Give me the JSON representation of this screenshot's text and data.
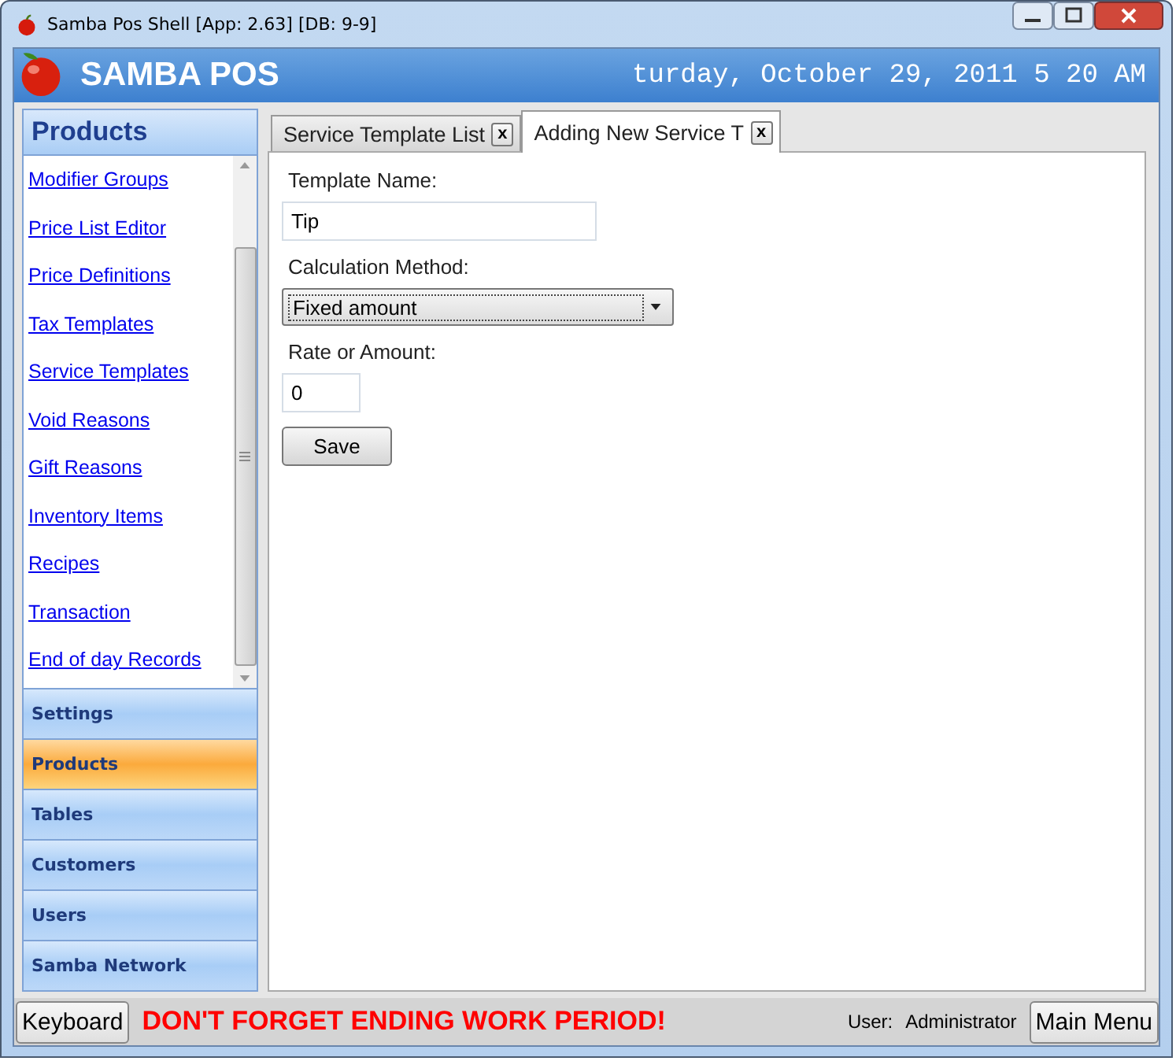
{
  "window": {
    "title": "Samba Pos Shell [App: 2.63] [DB: 9-9]"
  },
  "header": {
    "app_name": "SAMBA POS",
    "date": "turday, October 29, 2011 5 20 AM"
  },
  "sidebar": {
    "title": "Products",
    "links": [
      "Modifier Groups",
      "Price List Editor",
      "Price Definitions",
      "Tax Templates",
      "Service Templates",
      "Void Reasons",
      "Gift Reasons",
      "Inventory Items",
      "Recipes",
      "Transaction",
      "End of day Records"
    ],
    "sections": [
      {
        "label": "Settings",
        "selected": false
      },
      {
        "label": "Products",
        "selected": true
      },
      {
        "label": "Tables",
        "selected": false
      },
      {
        "label": "Customers",
        "selected": false
      },
      {
        "label": "Users",
        "selected": false
      },
      {
        "label": "Samba Network",
        "selected": false
      }
    ]
  },
  "tabs": [
    {
      "label": "Service Template List",
      "close": "x",
      "selected": false
    },
    {
      "label": "Adding New Service T",
      "close": "x",
      "selected": true
    }
  ],
  "form": {
    "template_name_label": "Template Name:",
    "template_name": "Tip",
    "method_label": "Calculation Method:",
    "method": "Fixed amount",
    "rate_label": "Rate or Amount:",
    "rate": "0",
    "save": "Save"
  },
  "status_bar": {
    "keyboard": "Keyboard",
    "warning": "DON'T FORGET ENDING WORK PERIOD!",
    "user_label": "User:",
    "user": "Administrator",
    "main_menu": "Main Menu"
  }
}
